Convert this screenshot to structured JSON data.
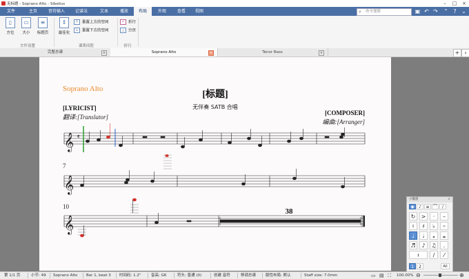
{
  "window": {
    "title": "无标题 - Soprano Alto - Sibelius"
  },
  "ribbon_tabs": [
    "文件",
    "主页",
    "音符输入",
    "记谱法",
    "文本",
    "播放",
    "布局",
    "外观",
    "查看",
    "视图"
  ],
  "search": {
    "placeholder": "命令搜索"
  },
  "ribbon": {
    "buttons": {
      "orientation": "方位",
      "size": "大小",
      "title_page": "标题页",
      "optimize": "最佳化",
      "reset_above": "重置上方的空间",
      "reset_below": "重置下方的空间",
      "break": "折行",
      "split": "分页"
    },
    "groups": {
      "document_setup": "文件设置",
      "staff_spacing": "谱表间距",
      "breaks": "折行"
    }
  },
  "document_tabs": [
    "完整总谱",
    "Soprano Alto",
    "Tenor Bass"
  ],
  "score": {
    "part_name": "Soprano Alto",
    "title": "[标题]",
    "subtitle": "无伴奏 SATB 合唱",
    "lyricist": "[LYRICIST]",
    "translator": "翻译:[Translator]",
    "composer": "[COMPOSER]",
    "arranger": "编曲:[Arranger]",
    "bar_numbers": [
      "7",
      "10"
    ],
    "multirest": "38"
  },
  "keypad": {
    "title": "小键盘",
    "bottom_tabs": [
      "1",
      "2"
    ],
    "all_label": "All"
  },
  "status": {
    "page": "第 1/1 页",
    "bars": "小节: 49",
    "part": "Soprano Alto",
    "position": "Bar 1, beat 3",
    "time": "时间码: 1.2\"",
    "pitch": "音高: G6",
    "notehead": "符头: 普通 (0)",
    "instrument": "创建 音符",
    "view": "移调总谱",
    "layout": "版性布局: 默认",
    "staff_size": "Staff size: 7.0mm",
    "zoom": "100.00%"
  },
  "colors": {
    "accent": "#4a6fa5",
    "part_name": "#e88a2c",
    "selection": "#d4302b"
  }
}
